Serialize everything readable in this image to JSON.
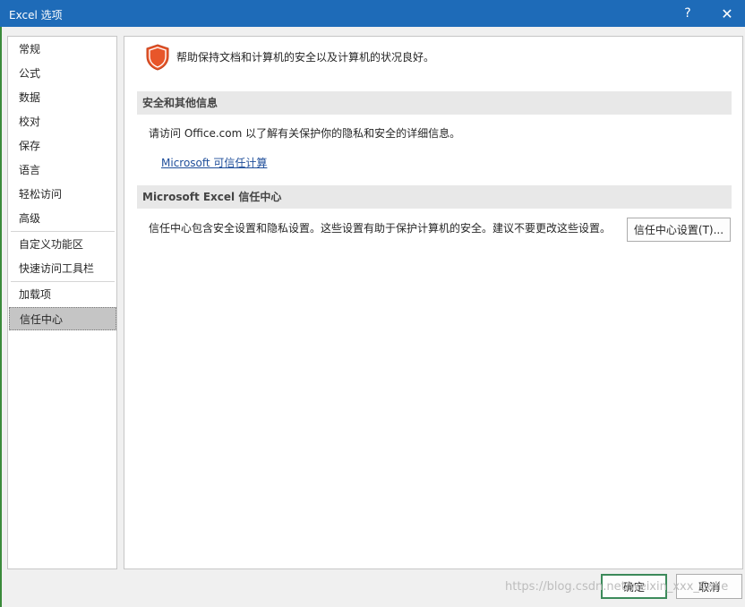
{
  "window": {
    "title": "Excel 选项",
    "help_label": "?",
    "close_label": "✕"
  },
  "nav": {
    "items": [
      {
        "label": "常规"
      },
      {
        "label": "公式"
      },
      {
        "label": "数据"
      },
      {
        "label": "校对"
      },
      {
        "label": "保存"
      },
      {
        "label": "语言"
      },
      {
        "label": "轻松访问"
      },
      {
        "label": "高级"
      },
      {
        "label": "自定义功能区"
      },
      {
        "label": "快速访问工具栏"
      },
      {
        "label": "加载项"
      },
      {
        "label": "信任中心"
      }
    ],
    "selected": "信任中心"
  },
  "content": {
    "intro": "帮助保持文档和计算机的安全以及计算机的状况良好。",
    "section1": {
      "header": "安全和其他信息",
      "text": "请访问 Office.com 以了解有关保护你的隐私和安全的详细信息。",
      "link": "Microsoft 可信任计算"
    },
    "section2": {
      "header": "Microsoft Excel 信任中心",
      "text": "信任中心包含安全设置和隐私设置。这些设置有助于保护计算机的安全。建议不要更改这些设置。",
      "button": "信任中心设置(T)..."
    }
  },
  "footer": {
    "ok_label": "确定",
    "cancel_label": "取消"
  },
  "watermark": "https://blog.csdn.net/weixin_xxx_Calle",
  "colors": {
    "titlebar": "#1e6bb8",
    "shield": "#e8562a",
    "link": "#1f4e9a",
    "primary_border": "#3c8a5a"
  }
}
